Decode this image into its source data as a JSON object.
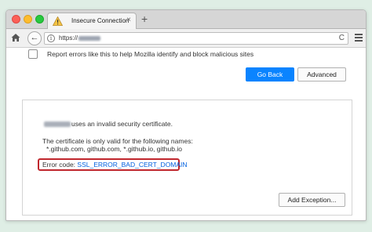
{
  "tab": {
    "title": "Insecure Connection",
    "close": "×",
    "new_tab": "+"
  },
  "navbar": {
    "back": "←",
    "info": "i",
    "url_prefix": "https://",
    "reload": "C"
  },
  "report": {
    "label": "Report errors like this to help Mozilla identify and block malicious sites",
    "checked": false
  },
  "buttons": {
    "go_back": "Go Back",
    "advanced": "Advanced",
    "add_exception": "Add Exception..."
  },
  "advanced_panel": {
    "invalid_cert": "uses an invalid security certificate.",
    "valid_for": "The certificate is only valid for the following names:",
    "names": "*.github.com, github.com, *.github.io, github.io",
    "error_label": "Error code:",
    "error_code": "SSL_ERROR_BAD_CERT_DOMAIN"
  },
  "colors": {
    "accent": "#0a84ff",
    "highlight": "#c0272d",
    "link": "#0060df"
  }
}
